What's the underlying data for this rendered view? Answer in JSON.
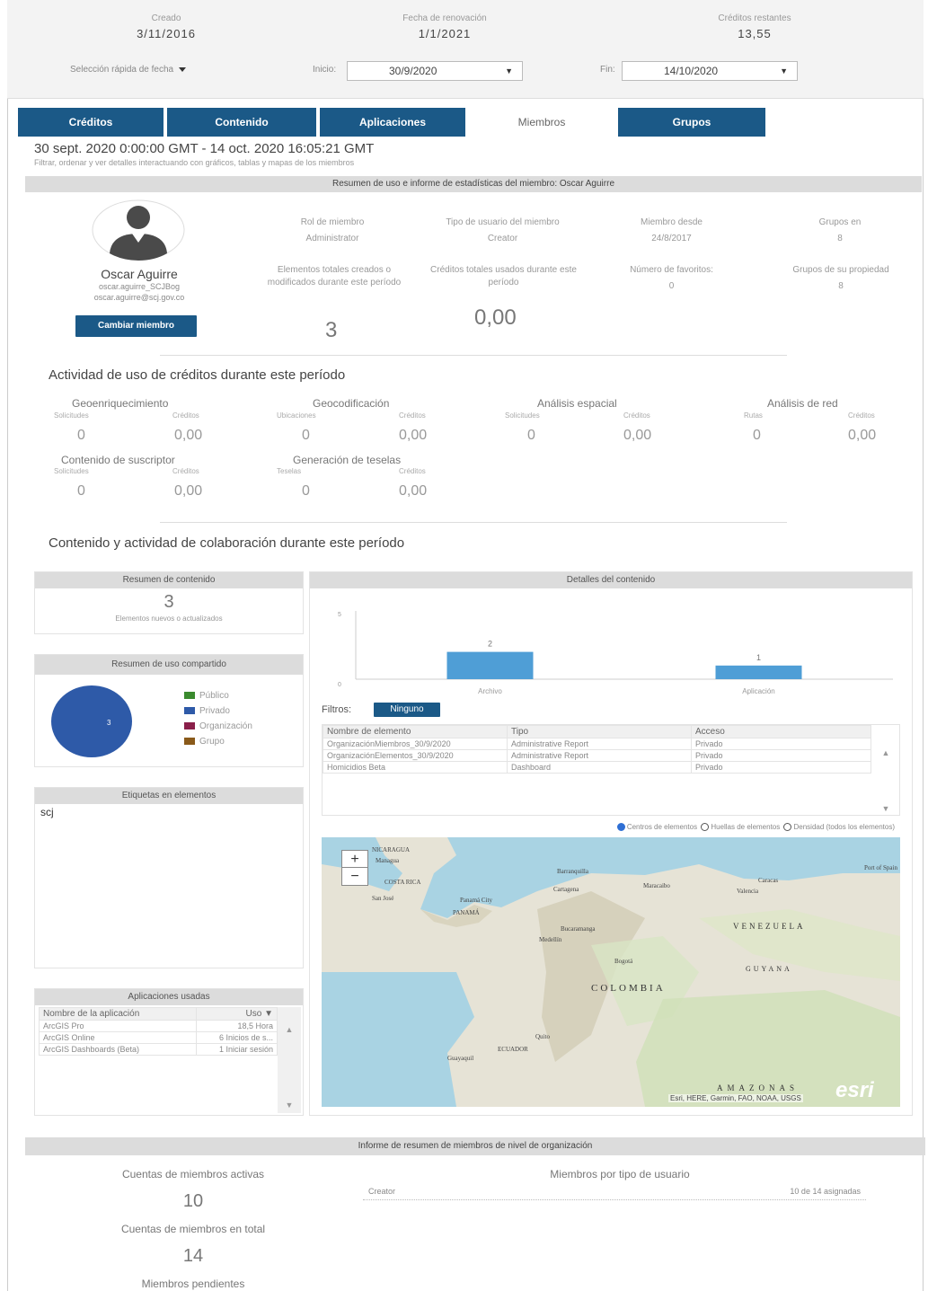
{
  "header": {
    "created_label": "Creado",
    "created_value": "3/11/2016",
    "renewal_label": "Fecha de renovación",
    "renewal_value": "1/1/2021",
    "credits_label": "Créditos restantes",
    "credits_value": "13,55",
    "quick_select_label": "Selección rápida de fecha",
    "start_label": "Inicio:",
    "start_value": "30/9/2020",
    "end_label": "Fin:",
    "end_value": "14/10/2020"
  },
  "tabs": [
    {
      "label": "Créditos",
      "active": false
    },
    {
      "label": "Contenido",
      "active": false
    },
    {
      "label": "Aplicaciones",
      "active": false
    },
    {
      "label": "Miembros",
      "active": true
    },
    {
      "label": "Grupos",
      "active": false
    }
  ],
  "range_text": "30 sept. 2020 0:00:00 GMT - 14 oct. 2020 16:05:21 GMT",
  "filter_hint": "Filtrar, ordenar y ver detalles interactuando con gráficos, tablas y mapas de los miembros",
  "member_section_title": "Resumen de uso e informe de estadísticas del miembro: Oscar Aguirre",
  "member": {
    "name": "Oscar Aguirre",
    "username": "oscar.aguirre_SCJBog",
    "email": "oscar.aguirre@scj.gov.co",
    "change_button": "Cambiar miembro",
    "role_label": "Rol de miembro",
    "role_value": "Administrator",
    "user_type_label": "Tipo de usuario del miembro",
    "user_type_value": "Creator",
    "member_since_label": "Miembro desde",
    "member_since_value": "24/8/2017",
    "groups_in_label": "Grupos en",
    "groups_in_value": "8",
    "items_label": "Elementos totales creados o modificados durante este período",
    "items_value": "3",
    "credits_used_label": "Créditos totales usados durante este período",
    "credits_used_value": "0,00",
    "favorites_label": "Número de favoritos:",
    "favorites_value": "0",
    "owned_groups_label": "Grupos de su propiedad",
    "owned_groups_value": "8"
  },
  "activity": {
    "title": "Actividad de uso de créditos durante este período",
    "items": [
      {
        "name": "Geoenriquecimiento",
        "left_label": "Solicitudes",
        "left_value": "0",
        "right_label": "Créditos",
        "right_value": "0,00"
      },
      {
        "name": "Geocodificación",
        "left_label": "Ubicaciones",
        "left_value": "0",
        "right_label": "Créditos",
        "right_value": "0,00"
      },
      {
        "name": "Análisis espacial",
        "left_label": "Solicitudes",
        "left_value": "0",
        "right_label": "Créditos",
        "right_value": "0,00"
      },
      {
        "name": "Análisis de red",
        "left_label": "Rutas",
        "left_value": "0",
        "right_label": "Créditos",
        "right_value": "0,00"
      },
      {
        "name": "Contenido de suscriptor",
        "left_label": "Solicitudes",
        "left_value": "0",
        "right_label": "Créditos",
        "right_value": "0,00"
      },
      {
        "name": "Generación de teselas",
        "left_label": "Teselas",
        "left_value": "0",
        "right_label": "Créditos",
        "right_value": "0,00"
      }
    ]
  },
  "collab_title": "Contenido y actividad de colaboración durante este período",
  "content_summary": {
    "title": "Resumen de contenido",
    "value": "3",
    "caption": "Elementos nuevos o actualizados"
  },
  "shared_summary": {
    "title": "Resumen de uso compartido",
    "pie_label": "3",
    "legend": [
      {
        "label": "Público",
        "color": "#3a8a2e"
      },
      {
        "label": "Privado",
        "color": "#2e5aa8"
      },
      {
        "label": "Organización",
        "color": "#8a1f4a"
      },
      {
        "label": "Grupo",
        "color": "#8a5a1a"
      }
    ]
  },
  "tags": {
    "title": "Etiquetas en elementos",
    "items": [
      "scj"
    ]
  },
  "apps_used": {
    "title": "Aplicaciones usadas",
    "col_name": "Nombre de la aplicación",
    "col_use": "Uso",
    "rows": [
      {
        "name": "ArcGIS Pro",
        "use": "18,5 Hora"
      },
      {
        "name": "ArcGIS Online",
        "use": "6 Inicios de s..."
      },
      {
        "name": "ArcGIS Dashboards (Beta)",
        "use": "1 Iniciar sesión"
      }
    ]
  },
  "content_details": {
    "title": "Detalles del contenido",
    "filters_label": "Filtros:",
    "filter_button": "Ninguno",
    "columns": [
      "Nombre de elemento",
      "Tipo",
      "Acceso"
    ],
    "rows": [
      [
        "OrganizaciónMiembros_30/9/2020",
        "Administrative Report",
        "Privado"
      ],
      [
        "OrganizaciónElementos_30/9/2020",
        "Administrative Report",
        "Privado"
      ],
      [
        "Homicidios Beta",
        "Dashboard",
        "Privado"
      ]
    ],
    "map_options": [
      "Centros de elementos",
      "Huellas de elementos",
      "Densidad (todos los elementos)"
    ],
    "map_labels": [
      "NICARAGUA",
      "Managua",
      "COSTA RICA",
      "San José",
      "Panamá City",
      "PANAMÁ",
      "Barranquilla",
      "Cartagena",
      "Maracaibo",
      "Caracas",
      "Valencia",
      "Port of Spain",
      "VENEZUELA",
      "Bucaramanga",
      "Medellín",
      "Bogotá",
      "GUYANA",
      "COLOMBIA",
      "Quito",
      "ECUADOR",
      "Guayaquil",
      "AMAZONAS",
      "Esri, HERE, Garmin, FAO, NOAA, USGS",
      "esri"
    ]
  },
  "chart_data": {
    "type": "bar",
    "categories": [
      "Archivo",
      "Aplicación"
    ],
    "values": [
      2,
      1
    ],
    "ylim": [
      0,
      5
    ],
    "yticks": [
      "5",
      "0"
    ],
    "color": "#4f9ed6"
  },
  "org_summary": {
    "title": "Informe de resumen de miembros de nivel de organización",
    "active_label": "Cuentas de miembros activas",
    "active_value": "10",
    "total_label": "Cuentas de miembros en total",
    "total_value": "14",
    "pending_label": "Miembros pendientes",
    "by_type_label": "Miembros por tipo de usuario",
    "type_name": "Creator",
    "type_value": "10 de 14 asignadas"
  }
}
